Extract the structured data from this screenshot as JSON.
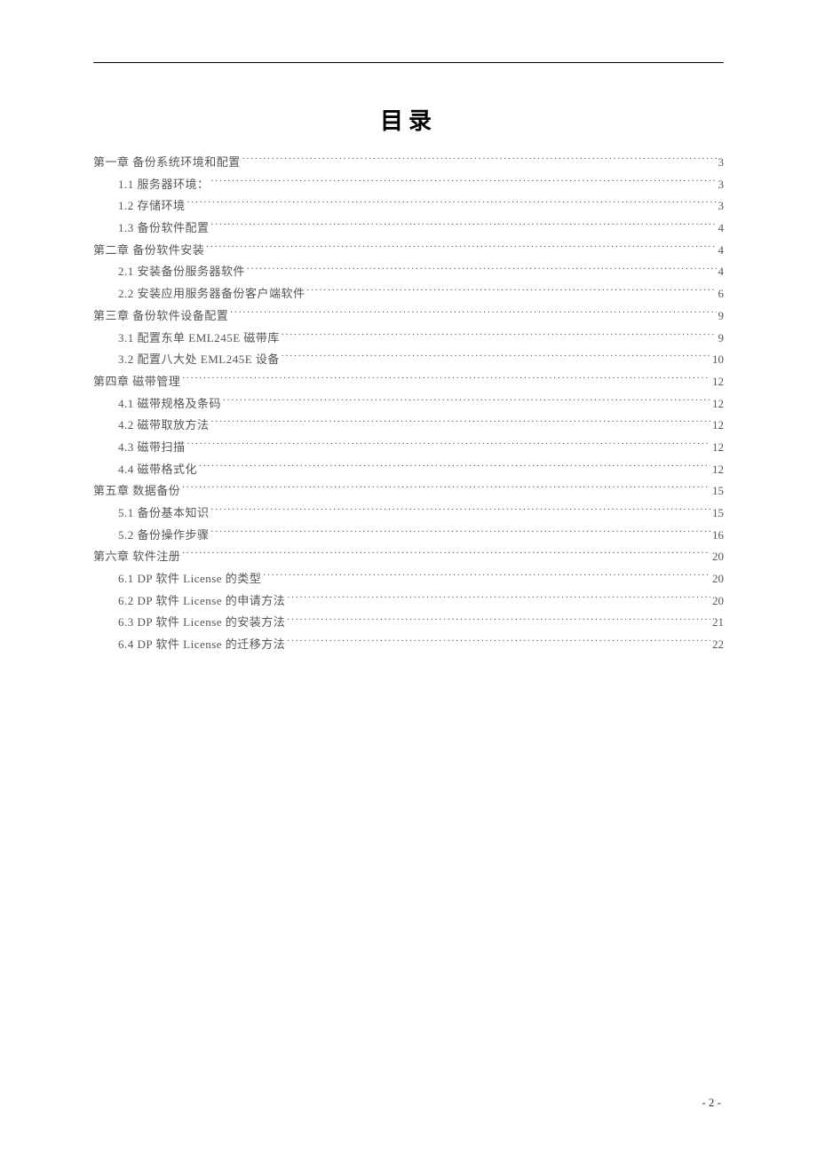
{
  "heading": "目录",
  "page_number": "- 2 -",
  "toc": [
    {
      "level": 1,
      "label": "第一章 备份系统环境和配置",
      "page": "3"
    },
    {
      "level": 2,
      "label": "1.1 服务器环境：",
      "page": "3"
    },
    {
      "level": 2,
      "label": "1.2 存储环境",
      "page": "3"
    },
    {
      "level": 2,
      "label": "1.3 备份软件配置",
      "page": "4"
    },
    {
      "level": 1,
      "label": "第二章 备份软件安装",
      "page": "4"
    },
    {
      "level": 2,
      "label": "2.1 安装备份服务器软件",
      "page": "4"
    },
    {
      "level": 2,
      "label": "2.2 安装应用服务器备份客户端软件",
      "page": "6"
    },
    {
      "level": 1,
      "label": "第三章 备份软件设备配置",
      "page": "9"
    },
    {
      "level": 2,
      "label": "3.1 配置东单 EML245E 磁带库",
      "page": "9"
    },
    {
      "level": 2,
      "label": "3.2 配置八大处 EML245E 设备",
      "page": "10"
    },
    {
      "level": 1,
      "label": "第四章 磁带管理",
      "page": "12"
    },
    {
      "level": 2,
      "label": "4.1 磁带规格及条码",
      "page": "12"
    },
    {
      "level": 2,
      "label": "4.2 磁带取放方法",
      "page": "12"
    },
    {
      "level": 2,
      "label": "4.3 磁带扫描",
      "page": "12"
    },
    {
      "level": 2,
      "label": "4.4 磁带格式化",
      "page": "12"
    },
    {
      "level": 1,
      "label": "第五章 数据备份",
      "page": "15"
    },
    {
      "level": 2,
      "label": "5.1 备份基本知识",
      "page": "15"
    },
    {
      "level": 2,
      "label": "5.2 备份操作步骤",
      "page": "16"
    },
    {
      "level": 1,
      "label": "第六章 软件注册",
      "page": "20"
    },
    {
      "level": 2,
      "label": "6.1 DP 软件 License 的类型",
      "page": "20"
    },
    {
      "level": 2,
      "label": "6.2 DP 软件 License 的申请方法",
      "page": "20"
    },
    {
      "level": 2,
      "label": "6.3 DP 软件 License 的安装方法",
      "page": "21"
    },
    {
      "level": 2,
      "label": "6.4 DP 软件 License 的迁移方法",
      "page": "22"
    }
  ]
}
